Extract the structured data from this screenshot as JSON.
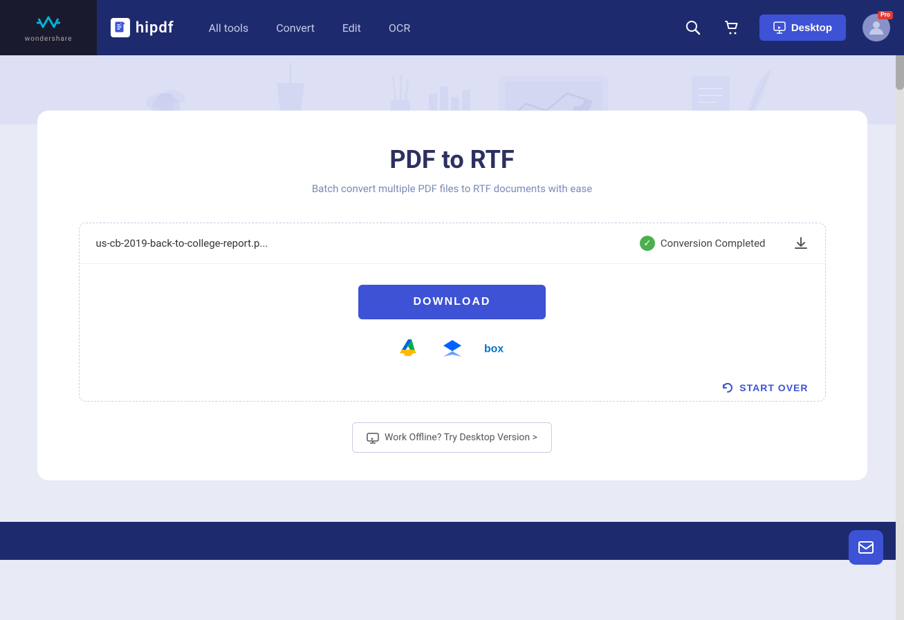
{
  "brand": {
    "wondershare_text": "wondershare",
    "hipdf_name": "hipdf"
  },
  "navbar": {
    "all_tools": "All tools",
    "convert": "Convert",
    "edit": "Edit",
    "ocr": "OCR",
    "desktop_btn": "Desktop",
    "pro_badge": "Pro"
  },
  "page": {
    "title": "PDF to RTF",
    "subtitle": "Batch convert multiple PDF files to RTF documents with ease"
  },
  "file": {
    "name": "us-cb-2019-back-to-college-report.p...",
    "status": "Conversion Completed"
  },
  "actions": {
    "download_btn": "DOWNLOAD",
    "start_over": "START OVER",
    "offline_banner": "Work Offline? Try Desktop Version >"
  },
  "cloud_icons": {
    "gdrive": "Google Drive",
    "dropbox": "Dropbox",
    "box": "Box"
  }
}
